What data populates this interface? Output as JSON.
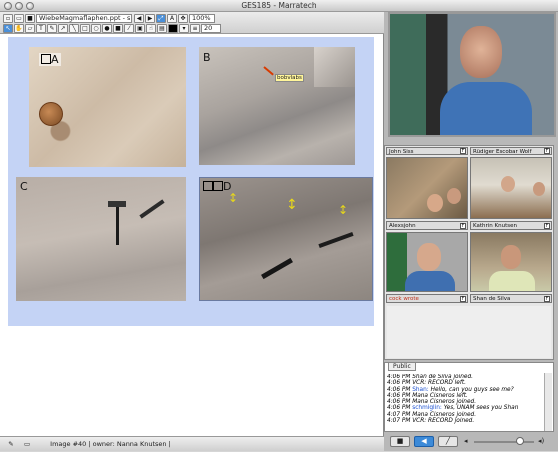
{
  "window": {
    "title": "GES185 - Marratech"
  },
  "toolbar": {
    "document_select": "WiebeMagmaflaphen.ppt - sli...",
    "zoom": "100%",
    "pen_size": "20"
  },
  "slide": {
    "panels": [
      {
        "label": "A"
      },
      {
        "label": "B",
        "annotation": "bobvlabs"
      },
      {
        "label": "C"
      },
      {
        "label": "D"
      }
    ]
  },
  "statusbar": {
    "text": "Image #40 | owner: Nanna Knutsen |"
  },
  "participants": [
    {
      "name": "John Siss"
    },
    {
      "name": "Rüdiger Escobar Wolf"
    },
    {
      "name": "Alexsjohn"
    },
    {
      "name": "Kathrin Knutsen"
    },
    {
      "name": "cock wrote"
    },
    {
      "name": "Shan de Silva"
    }
  ],
  "chat": {
    "tab": "Public",
    "lines": [
      {
        "time": "4:06 PM",
        "who": "",
        "text": "Shan de Silva joined."
      },
      {
        "time": "4:06 PM",
        "who": "",
        "text": "VCR: RECORD left."
      },
      {
        "time": "4:06 PM",
        "who": "Shan:",
        "text": "Hello, can you guys see me?"
      },
      {
        "time": "4:06 PM",
        "who": "",
        "text": "Mana Cisneros left."
      },
      {
        "time": "4:06 PM",
        "who": "",
        "text": "Mana Cisneros joined."
      },
      {
        "time": "4:06 PM",
        "who": "schmiglin:",
        "text": "Yes, UNAM sees you Shan"
      },
      {
        "time": "4:07 PM",
        "who": "",
        "text": "Mana Cisneros joined."
      },
      {
        "time": "4:07 PM",
        "who": "",
        "text": "VCR: RECORD joined."
      }
    ]
  }
}
